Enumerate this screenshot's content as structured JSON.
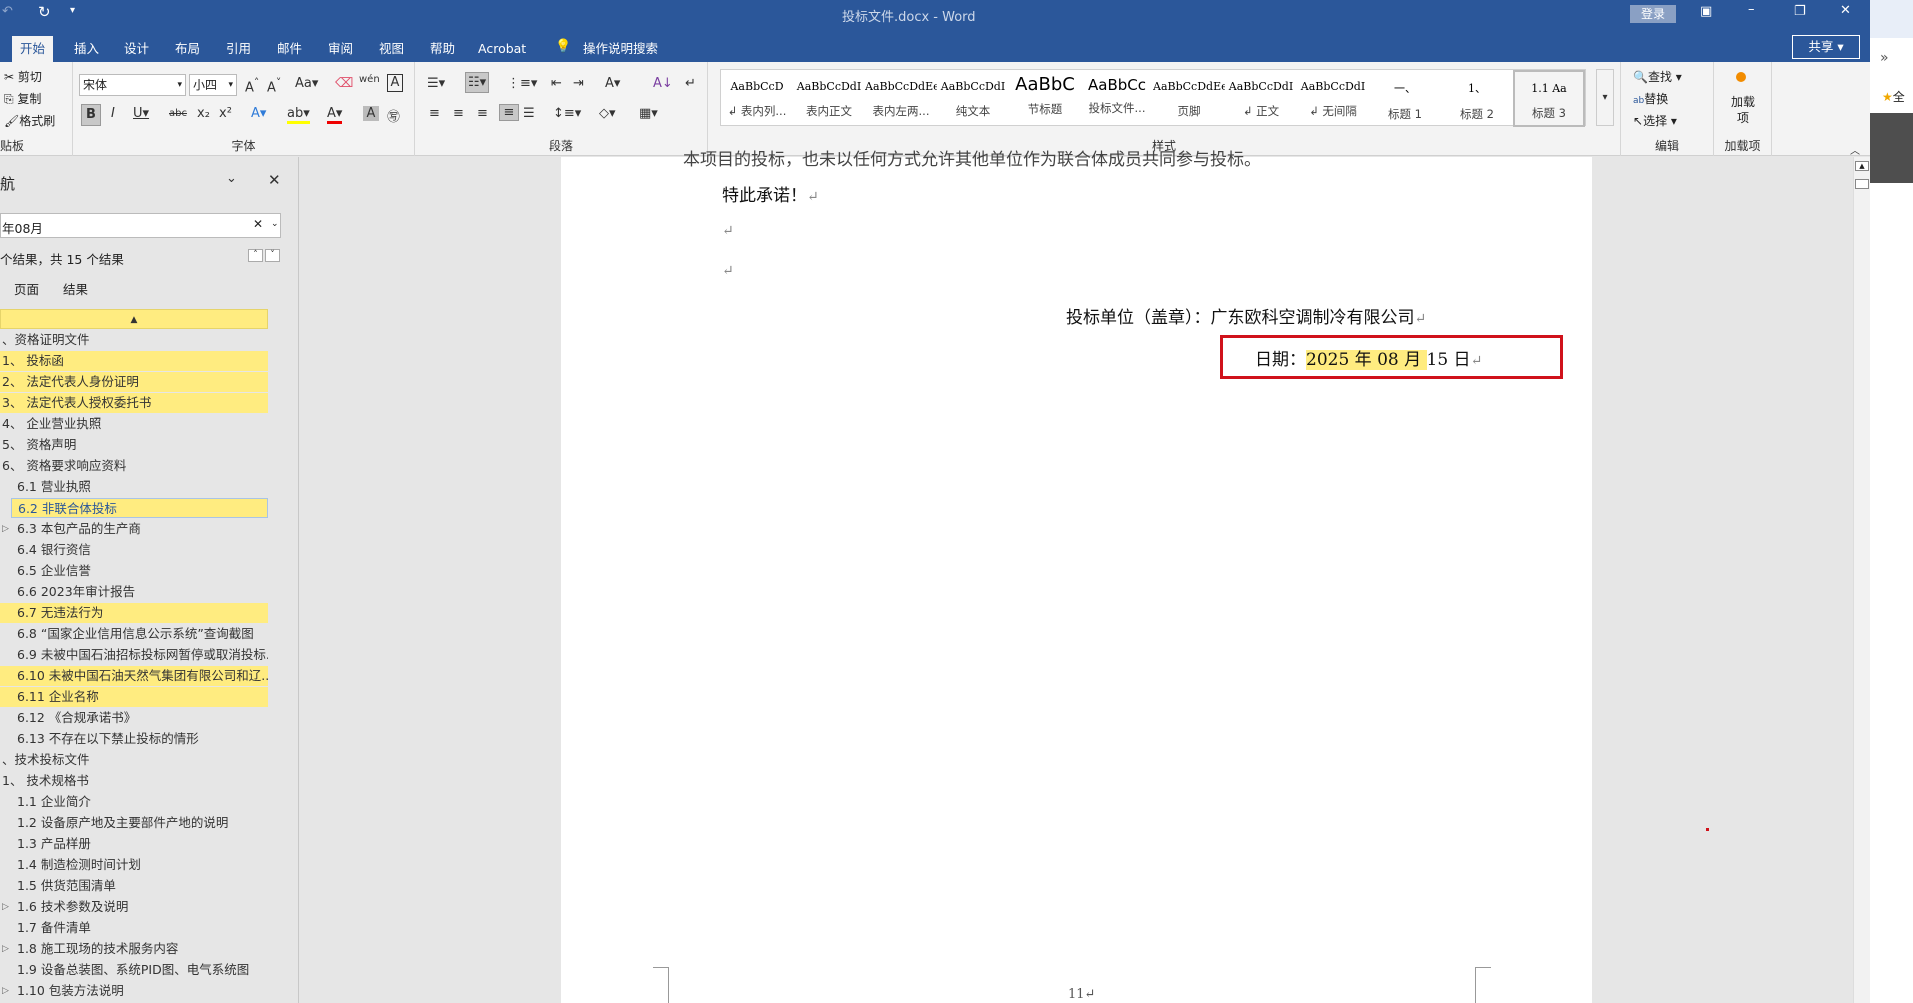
{
  "window": {
    "title": "投标文件.docx  -  Word",
    "login": "登录",
    "share": "共享"
  },
  "tabs": [
    "开始",
    "插入",
    "设计",
    "布局",
    "引用",
    "邮件",
    "审阅",
    "视图",
    "帮助",
    "Acrobat"
  ],
  "tell_me": "操作说明搜索",
  "clipboard": {
    "cut": "剪切",
    "copy": "复制",
    "format_painter": "格式刷",
    "label": "贴板"
  },
  "font": {
    "name": "宋体",
    "size": "小四",
    "label": "字体"
  },
  "paragraph": {
    "label": "段落"
  },
  "styles": {
    "label": "样式",
    "items": [
      {
        "sample": "AaBbCcD",
        "name": "↲ 表内列..."
      },
      {
        "sample": "AaBbCcDdI",
        "name": "表内正文"
      },
      {
        "sample": "AaBbCcDdEe",
        "name": "表内左两..."
      },
      {
        "sample": "AaBbCcDdI",
        "name": "纯文本"
      },
      {
        "sample": "AaBbC",
        "name": "节标题"
      },
      {
        "sample": "AaBbCc",
        "name": "投标文件..."
      },
      {
        "sample": "AaBbCcDdEe",
        "name": "页脚"
      },
      {
        "sample": "AaBbCcDdI",
        "name": "↲ 正文"
      },
      {
        "sample": "AaBbCcDdI",
        "name": "↲ 无间隔"
      },
      {
        "sample": "一、",
        "name": "标题 1"
      },
      {
        "sample": "1、",
        "name": "标题 2"
      },
      {
        "sample": "1.1  Aa",
        "name": "标题 3"
      }
    ]
  },
  "editing": {
    "find": "查找",
    "replace": "替换",
    "select": "选择",
    "label": "编辑"
  },
  "addins": {
    "button": "加载项",
    "label": "加载项"
  },
  "nav": {
    "title_fragment": "航",
    "search_value": "年08月",
    "result_text": "个结果，共 15 个结果",
    "tab_pages": "页面",
    "tab_results": "结果",
    "items": [
      {
        "text": "、资格证明文件",
        "hl": false,
        "lvl": 0
      },
      {
        "text": "1、  投标函",
        "hl": true,
        "lvl": 0
      },
      {
        "text": "2、  法定代表人身份证明",
        "hl": true,
        "lvl": 0
      },
      {
        "text": "3、  法定代表人授权委托书",
        "hl": true,
        "lvl": 0
      },
      {
        "text": "4、  企业营业执照",
        "hl": false,
        "lvl": 0
      },
      {
        "text": "5、  资格声明",
        "hl": false,
        "lvl": 0
      },
      {
        "text": "6、  资格要求响应资料",
        "hl": false,
        "lvl": 0
      },
      {
        "text": "6.1 营业执照",
        "hl": false,
        "lvl": 1
      },
      {
        "text": "6.2 非联合体投标",
        "hl": true,
        "lvl": 1,
        "cur": true
      },
      {
        "text": "6.3 本包产品的生产商",
        "hl": false,
        "lvl": 1,
        "exp": true
      },
      {
        "text": "6.4 银行资信",
        "hl": false,
        "lvl": 1
      },
      {
        "text": "6.5 企业信誉",
        "hl": false,
        "lvl": 1
      },
      {
        "text": "6.6 2023年审计报告",
        "hl": false,
        "lvl": 1
      },
      {
        "text": "6.7 无违法行为",
        "hl": true,
        "lvl": 1
      },
      {
        "text": "6.8 “国家企业信用信息公示系统”查询截图",
        "hl": false,
        "lvl": 1
      },
      {
        "text": "6.9 未被中国石油招标投标网暂停或取消投标...",
        "hl": false,
        "lvl": 1
      },
      {
        "text": "6.10 未被中国石油天然气集团有限公司和辽...",
        "hl": true,
        "lvl": 1
      },
      {
        "text": "6.11 企业名称",
        "hl": true,
        "lvl": 1
      },
      {
        "text": "6.12 《合规承诺书》",
        "hl": false,
        "lvl": 1
      },
      {
        "text": "6.13 不存在以下禁止投标的情形",
        "hl": false,
        "lvl": 1
      },
      {
        "text": "、技术投标文件",
        "hl": false,
        "lvl": 0
      },
      {
        "text": "1、  技术规格书",
        "hl": false,
        "lvl": 0
      },
      {
        "text": "1.1 企业简介",
        "hl": false,
        "lvl": 1
      },
      {
        "text": "1.2 设备原产地及主要部件产地的说明",
        "hl": false,
        "lvl": 1
      },
      {
        "text": "1.3 产品样册",
        "hl": false,
        "lvl": 1
      },
      {
        "text": "1.4 制造检测时间计划",
        "hl": false,
        "lvl": 1
      },
      {
        "text": "1.5 供货范围清单",
        "hl": false,
        "lvl": 1
      },
      {
        "text": "1.6 技术参数及说明",
        "hl": false,
        "lvl": 1,
        "exp": true
      },
      {
        "text": "1.7 备件清单",
        "hl": false,
        "lvl": 1
      },
      {
        "text": "1.8 施工现场的技术服务内容",
        "hl": false,
        "lvl": 1,
        "exp": true
      },
      {
        "text": "1.9 设备总装图、系统PID图、电气系统图",
        "hl": false,
        "lvl": 1
      },
      {
        "text": "1.10 包装方法说明",
        "hl": false,
        "lvl": 1,
        "exp": true
      }
    ]
  },
  "doc": {
    "top_cut": "本项目的投标，也未以任何方式允许其他单位作为联合体成员共同参与投标。",
    "promise": "特此承诺！",
    "bidder": "投标单位（盖章）：广东欧科空调制冷有限公司",
    "date_label": "日期：",
    "date_hl": "2025 年 08 月 ",
    "date_rest": "15 日",
    "page_num": "11"
  },
  "right": {
    "fav_fragment": "全"
  },
  "colors": {
    "accent": "#2b579a",
    "highlight": "#ffec80",
    "red_box": "#d0121b"
  }
}
